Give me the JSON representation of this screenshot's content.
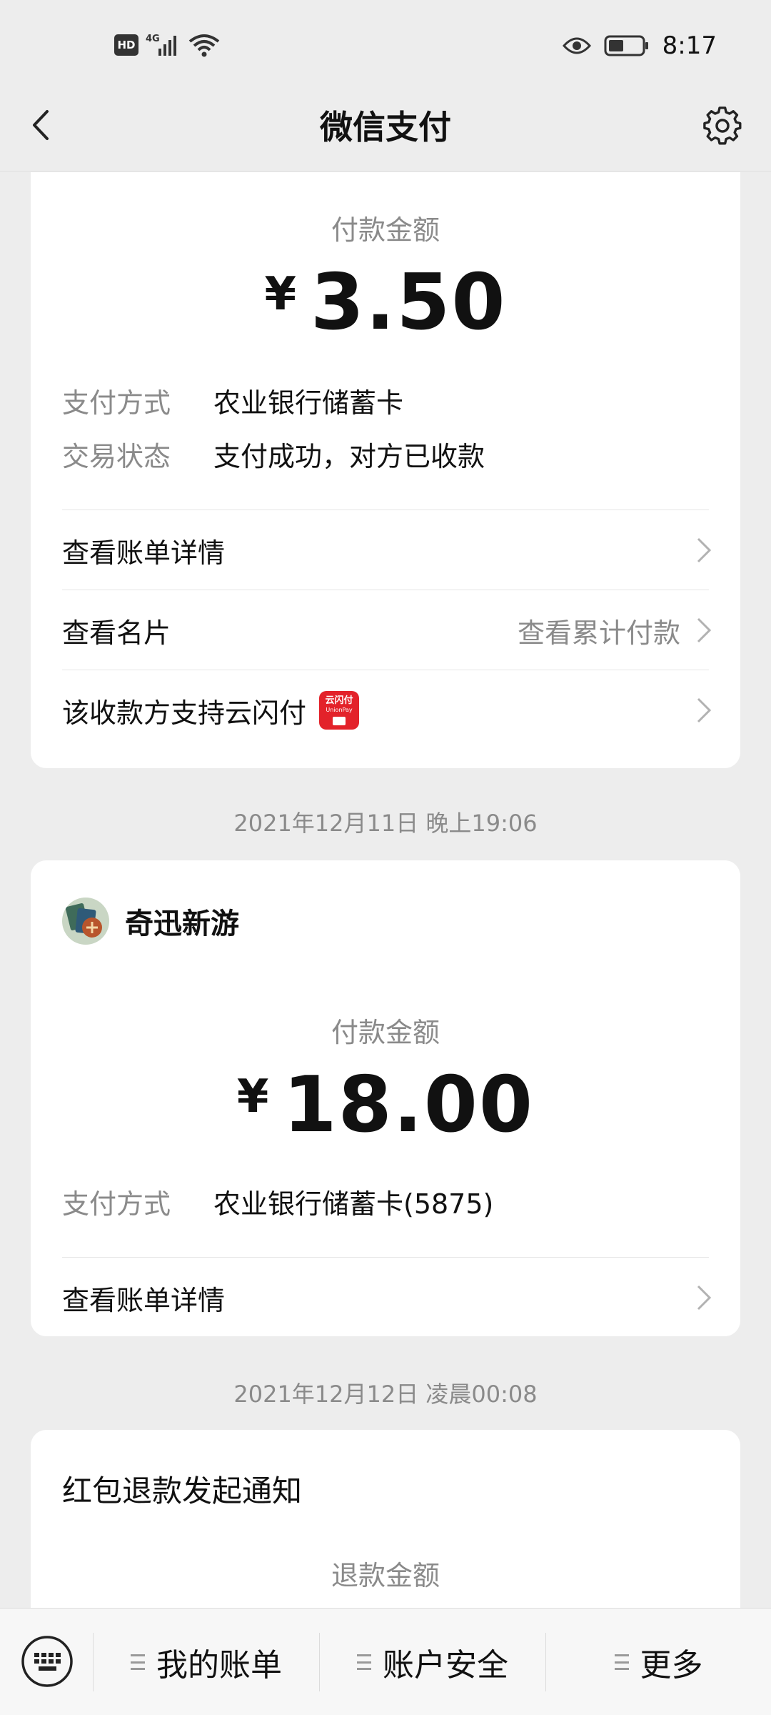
{
  "status_bar": {
    "hd": "HD",
    "network": "4G",
    "time": "8:17"
  },
  "navbar": {
    "title": "微信支付"
  },
  "cards": [
    {
      "amount_label": "付款金额",
      "currency": "¥",
      "amount": "3.50",
      "info": [
        {
          "key": "支付方式",
          "value": "农业银行储蓄卡"
        },
        {
          "key": "交易状态",
          "value": "支付成功，对方已收款"
        }
      ],
      "links": [
        {
          "label": "查看账单详情",
          "side": ""
        },
        {
          "label": "查看名片",
          "side": "查看累计付款"
        },
        {
          "label": "该收款方支持云闪付",
          "side": ""
        }
      ],
      "yunshan_text": "云闪付",
      "yunshan_sub": "UnionPay"
    },
    {
      "timestamp": "2021年12月11日 晚上19:06",
      "merchant": "奇迅新游",
      "amount_label": "付款金额",
      "currency": "¥",
      "amount": "18.00",
      "info": [
        {
          "key": "支付方式",
          "value": "农业银行储蓄卡(5875)"
        }
      ],
      "links": [
        {
          "label": "查看账单详情",
          "side": ""
        }
      ]
    },
    {
      "timestamp": "2021年12月12日 凌晨00:08",
      "title": "红包退款发起通知",
      "amount_label": "退款金额"
    }
  ],
  "bottom_bar": {
    "items": [
      "我的账单",
      "账户安全",
      "更多"
    ]
  },
  "colors": {
    "background": "#ededed",
    "card": "#ffffff",
    "muted_text": "#8a8a8a",
    "yunshan_red": "#e3222a"
  }
}
